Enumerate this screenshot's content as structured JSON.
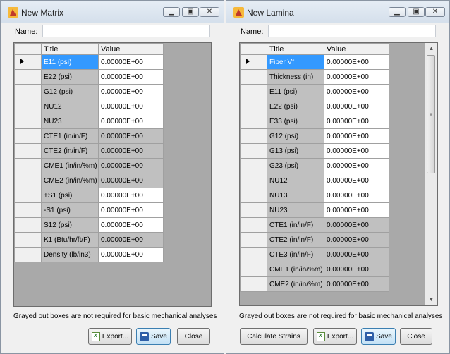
{
  "left": {
    "title": "New Matrix",
    "name_label": "Name:",
    "name_value": "",
    "grid": {
      "headers": [
        "Title",
        "Value"
      ],
      "rows": [
        {
          "title": "E11 (psi)",
          "value": "0.00000E+00",
          "gray": false
        },
        {
          "title": "E22 (psi)",
          "value": "0.00000E+00",
          "gray": false
        },
        {
          "title": "G12 (psi)",
          "value": "0.00000E+00",
          "gray": false
        },
        {
          "title": "NU12",
          "value": "0.00000E+00",
          "gray": false
        },
        {
          "title": "NU23",
          "value": "0.00000E+00",
          "gray": false
        },
        {
          "title": "CTE1 (in/in/F)",
          "value": "0.00000E+00",
          "gray": true
        },
        {
          "title": "CTE2 (in/in/F)",
          "value": "0.00000E+00",
          "gray": true
        },
        {
          "title": "CME1 (in/in/%m)",
          "value": "0.00000E+00",
          "gray": true
        },
        {
          "title": "CME2 (in/in/%m)",
          "value": "0.00000E+00",
          "gray": true
        },
        {
          "title": "+S1 (psi)",
          "value": "0.00000E+00",
          "gray": false
        },
        {
          "title": "-S1 (psi)",
          "value": "0.00000E+00",
          "gray": false
        },
        {
          "title": "S12 (psi)",
          "value": "0.00000E+00",
          "gray": false
        },
        {
          "title": "K1 (Btu/hr/ft/F)",
          "value": "0.00000E+00",
          "gray": true
        },
        {
          "title": "Density (lb/in3)",
          "value": "0.00000E+00",
          "gray": false
        }
      ]
    },
    "note": "Grayed out boxes are not required for basic mechanical analyses",
    "buttons": {
      "export": "Export...",
      "save": "Save",
      "close": "Close"
    }
  },
  "right": {
    "title": "New Lamina",
    "name_label": "Name:",
    "name_value": "",
    "grid": {
      "headers": [
        "Title",
        "Value"
      ],
      "rows": [
        {
          "title": "Fiber Vf",
          "value": "0.00000E+00",
          "gray": false
        },
        {
          "title": "Thickness (in)",
          "value": "0.00000E+00",
          "gray": false
        },
        {
          "title": "E11 (psi)",
          "value": "0.00000E+00",
          "gray": false
        },
        {
          "title": "E22 (psi)",
          "value": "0.00000E+00",
          "gray": false
        },
        {
          "title": "E33 (psi)",
          "value": "0.00000E+00",
          "gray": false
        },
        {
          "title": "G12 (psi)",
          "value": "0.00000E+00",
          "gray": false
        },
        {
          "title": "G13 (psi)",
          "value": "0.00000E+00",
          "gray": false
        },
        {
          "title": "G23 (psi)",
          "value": "0.00000E+00",
          "gray": false
        },
        {
          "title": "NU12",
          "value": "0.00000E+00",
          "gray": false
        },
        {
          "title": "NU13",
          "value": "0.00000E+00",
          "gray": false
        },
        {
          "title": "NU23",
          "value": "0.00000E+00",
          "gray": false
        },
        {
          "title": "CTE1 (in/in/F)",
          "value": "0.00000E+00",
          "gray": true
        },
        {
          "title": "CTE2 (in/in/F)",
          "value": "0.00000E+00",
          "gray": true
        },
        {
          "title": "CTE3 (in/in/F)",
          "value": "0.00000E+00",
          "gray": true
        },
        {
          "title": "CME1 (in/in/%m)",
          "value": "0.00000E+00",
          "gray": true
        },
        {
          "title": "CME2 (in/in/%m)",
          "value": "0.00000E+00",
          "gray": true
        }
      ]
    },
    "note": "Grayed out boxes are not required for basic mechanical analyses",
    "buttons": {
      "calculate": "Calculate Strains",
      "export": "Export...",
      "save": "Save",
      "close": "Close"
    }
  },
  "colors": {
    "selected": "#3399ff",
    "gray_cell": "#c0c0c0",
    "grid_background": "#a9a9a9"
  },
  "icons": [
    "app-icon",
    "minimize-icon",
    "maximize-icon",
    "close-icon",
    "excel-export-icon",
    "save-disk-icon",
    "row-pointer-icon"
  ]
}
